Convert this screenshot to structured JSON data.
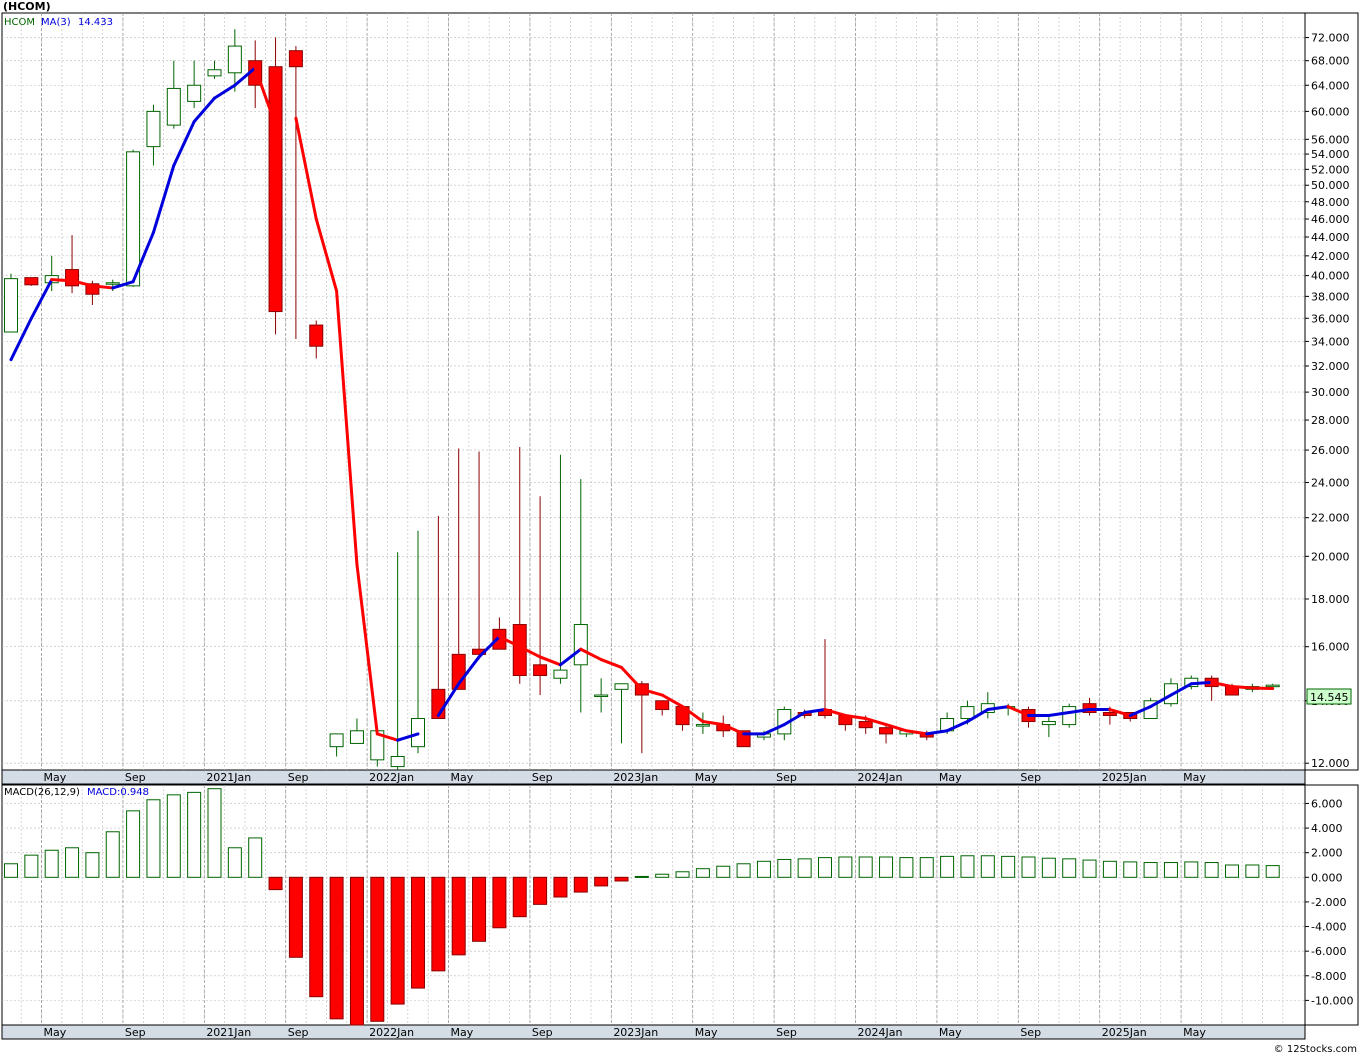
{
  "title": "(HCOM)",
  "copyright": "© 12Stocks.com",
  "colors": {
    "up": "#006400",
    "down": "#ff0000",
    "ma_up": "#0000dd",
    "ma_down": "#ff0000",
    "grid": "#bbbbbb",
    "axis_bg": "#d4dde6",
    "last_bg": "#ccffcc"
  },
  "chart_data": [
    {
      "type": "candlestick",
      "name": "price",
      "legend": {
        "symbol": "HCOM",
        "ma_label": "MA(3)",
        "ma_value": "14.433"
      },
      "last_price": "14.545",
      "y_scale": "log",
      "ylim": [
        11.8,
        76.5
      ],
      "y_ticks": [
        12,
        14,
        16,
        18,
        20,
        22,
        24,
        26,
        28,
        30,
        32,
        34,
        36,
        38,
        40,
        42,
        44,
        46,
        48,
        50,
        52,
        54,
        56,
        60,
        64,
        68,
        72
      ],
      "y_tick_labels": [
        "12.000",
        "14.000",
        "16.000",
        "18.000",
        "20.000",
        "22.000",
        "24.000",
        "26.000",
        "28.000",
        "30.000",
        "32.000",
        "34.000",
        "36.000",
        "38.000",
        "40.000",
        "42.000",
        "44.000",
        "46.000",
        "48.000",
        "50.000",
        "52.000",
        "54.000",
        "56.000",
        "60.000",
        "64.000",
        "68.000",
        "72.000"
      ],
      "x_tick_labels": [
        {
          "i": 2,
          "label": "May"
        },
        {
          "i": 6,
          "label": "Sep"
        },
        {
          "i": 10,
          "label": "2021Jan"
        },
        {
          "i": 14,
          "label": "Sep"
        },
        {
          "i": 18,
          "label": "2022Jan"
        },
        {
          "i": 22,
          "label": "May"
        },
        {
          "i": 26,
          "label": "Sep"
        },
        {
          "i": 30,
          "label": "2023Jan"
        },
        {
          "i": 34,
          "label": "May"
        },
        {
          "i": 38,
          "label": "Sep"
        },
        {
          "i": 42,
          "label": "2024Jan"
        },
        {
          "i": 46,
          "label": "May"
        },
        {
          "i": 50,
          "label": "Sep"
        },
        {
          "i": 54,
          "label": "2025Jan"
        },
        {
          "i": 58,
          "label": "May"
        }
      ],
      "ohlc": [
        [
          34.8,
          40.2,
          34.8,
          39.7
        ],
        [
          39.8,
          39.8,
          39.0,
          39.1
        ],
        [
          39.3,
          42.0,
          38.5,
          40.0
        ],
        [
          40.6,
          44.2,
          38.3,
          39.0
        ],
        [
          39.2,
          39.5,
          37.2,
          38.2
        ],
        [
          39.2,
          39.6,
          38.5,
          39.3
        ],
        [
          39.0,
          54.6,
          38.9,
          54.3
        ],
        [
          55.0,
          61.0,
          52.5,
          60.0
        ],
        [
          58.0,
          68.0,
          57.5,
          63.5
        ],
        [
          61.5,
          68.0,
          60.5,
          64.0
        ],
        [
          65.5,
          68.0,
          65.0,
          66.5
        ],
        [
          66.0,
          73.5,
          63.0,
          70.5
        ],
        [
          68.0,
          71.5,
          60.5,
          64.0
        ],
        [
          67.0,
          72.0,
          34.6,
          36.6
        ],
        [
          69.7,
          70.5,
          34.2,
          67.0
        ],
        [
          35.4,
          35.8,
          32.6,
          33.6
        ],
        [
          12.5,
          12.6,
          12.2,
          12.9
        ],
        [
          12.6,
          13.4,
          12.6,
          13.0
        ],
        [
          12.1,
          13.0,
          11.9,
          13.0
        ],
        [
          11.9,
          20.2,
          11.8,
          12.2
        ],
        [
          12.5,
          21.3,
          12.3,
          13.4
        ],
        [
          14.4,
          22.1,
          13.8,
          13.4
        ],
        [
          15.7,
          26.1,
          15.3,
          14.4
        ],
        [
          15.9,
          25.9,
          15.5,
          15.7
        ],
        [
          16.7,
          17.2,
          16.2,
          15.9
        ],
        [
          16.9,
          26.2,
          14.6,
          14.9
        ],
        [
          15.3,
          23.2,
          14.2,
          14.9
        ],
        [
          14.8,
          25.7,
          14.6,
          15.1
        ],
        [
          15.3,
          24.2,
          13.6,
          16.9
        ],
        [
          14.2,
          14.8,
          13.6,
          14.2
        ],
        [
          14.4,
          14.4,
          12.6,
          14.6
        ],
        [
          14.6,
          14.7,
          12.3,
          14.2
        ],
        [
          14.0,
          14.0,
          13.5,
          13.7
        ],
        [
          13.8,
          13.8,
          13.0,
          13.2
        ],
        [
          13.2,
          13.6,
          12.9,
          13.2
        ],
        [
          13.2,
          13.5,
          12.8,
          13.0
        ],
        [
          13.0,
          13.0,
          12.5,
          12.5
        ],
        [
          12.8,
          13.0,
          12.7,
          12.9
        ],
        [
          12.9,
          13.8,
          12.7,
          13.7
        ],
        [
          13.6,
          13.7,
          13.4,
          13.5
        ],
        [
          13.7,
          16.3,
          13.4,
          13.5
        ],
        [
          13.5,
          13.5,
          13.0,
          13.2
        ],
        [
          13.3,
          13.5,
          12.9,
          13.1
        ],
        [
          13.1,
          13.2,
          12.6,
          12.9
        ],
        [
          12.9,
          13.0,
          12.8,
          13.0
        ],
        [
          12.9,
          13.0,
          12.7,
          12.8
        ],
        [
          13.0,
          13.6,
          12.9,
          13.4
        ],
        [
          13.4,
          14.0,
          13.2,
          13.8
        ],
        [
          13.6,
          14.3,
          13.4,
          13.9
        ],
        [
          13.8,
          13.9,
          13.5,
          13.8
        ],
        [
          13.7,
          13.8,
          13.1,
          13.3
        ],
        [
          13.2,
          13.5,
          12.8,
          13.3
        ],
        [
          13.2,
          13.9,
          13.1,
          13.8
        ],
        [
          13.9,
          14.1,
          13.5,
          13.6
        ],
        [
          13.6,
          13.8,
          13.2,
          13.5
        ],
        [
          13.6,
          13.6,
          13.3,
          13.4
        ],
        [
          13.4,
          14.1,
          13.4,
          14.0
        ],
        [
          13.9,
          14.8,
          13.8,
          14.6
        ],
        [
          14.5,
          14.9,
          14.4,
          14.8
        ],
        [
          14.8,
          14.9,
          14.0,
          14.5
        ],
        [
          14.5,
          14.6,
          14.2,
          14.2
        ],
        [
          14.4,
          14.6,
          14.3,
          14.5
        ],
        [
          14.5,
          14.6,
          14.4,
          14.55
        ]
      ],
      "ma": [
        32.5,
        36.0,
        39.6,
        39.5,
        39.0,
        38.8,
        39.4,
        44.5,
        52.5,
        58.5,
        62.0,
        64.0,
        66.8,
        58.0,
        59.0,
        46.0,
        38.5,
        19.6,
        12.9,
        12.7,
        12.9,
        13.5,
        14.6,
        15.6,
        16.4,
        16.0,
        15.6,
        15.3,
        15.9,
        15.5,
        15.2,
        14.4,
        14.2,
        13.8,
        13.3,
        13.2,
        12.9,
        12.9,
        13.2,
        13.6,
        13.7,
        13.5,
        13.4,
        13.2,
        13.0,
        12.9,
        13.0,
        13.3,
        13.7,
        13.8,
        13.5,
        13.5,
        13.6,
        13.7,
        13.7,
        13.5,
        13.8,
        14.2,
        14.6,
        14.65,
        14.5,
        14.45,
        14.43
      ],
      "ma_breaks": [
        13,
        20
      ]
    },
    {
      "type": "bar",
      "name": "macd",
      "legend": {
        "label": "MACD(26,12,9)",
        "value_label": "MACD:0.948"
      },
      "ylim": [
        -12,
        7.5
      ],
      "y_ticks": [
        6,
        4,
        2,
        0,
        -2,
        -4,
        -6,
        -8,
        -10
      ],
      "y_tick_labels": [
        "6.000",
        "4.000",
        "2.000",
        "0.000",
        "-2.000",
        "-4.000",
        "-6.000",
        "-8.000",
        "-10.000"
      ],
      "values": [
        1.1,
        1.8,
        2.2,
        2.4,
        2.0,
        3.7,
        5.4,
        6.3,
        6.7,
        6.9,
        7.2,
        2.4,
        3.2,
        -1.0,
        -6.5,
        -9.7,
        -11.5,
        -12.0,
        -11.7,
        -10.3,
        -9.0,
        -7.6,
        -6.3,
        -5.2,
        -4.1,
        -3.2,
        -2.2,
        -1.6,
        -1.2,
        -0.7,
        -0.3,
        0.07,
        0.25,
        0.45,
        0.7,
        0.9,
        1.1,
        1.3,
        1.45,
        1.5,
        1.6,
        1.65,
        1.65,
        1.65,
        1.6,
        1.6,
        1.7,
        1.75,
        1.75,
        1.7,
        1.65,
        1.55,
        1.5,
        1.4,
        1.3,
        1.25,
        1.2,
        1.2,
        1.25,
        1.2,
        1.0,
        1.0,
        0.95
      ]
    }
  ]
}
